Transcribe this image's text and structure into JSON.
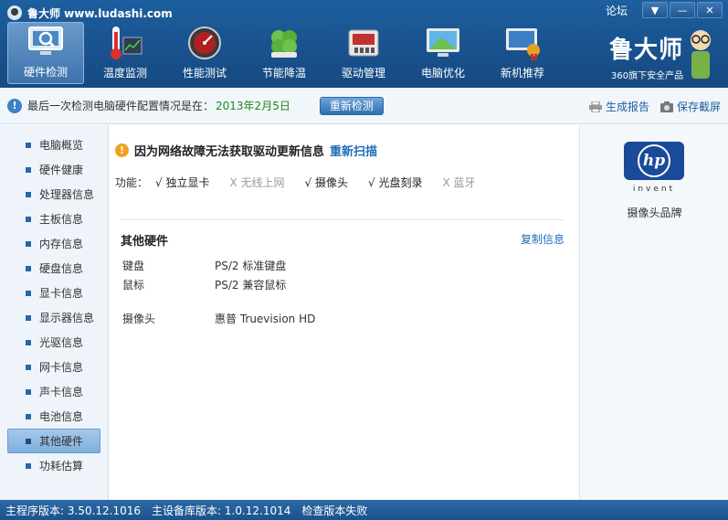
{
  "app": {
    "title": "鲁大师 www.ludashi.com",
    "forum": "论坛",
    "menu_glyph": "▼",
    "minimize_glyph": "—",
    "close_glyph": "✕"
  },
  "toolbar": [
    {
      "label": "硬件检测",
      "icon": "monitor-magnifier-icon",
      "active": true
    },
    {
      "label": "温度监测",
      "icon": "thermometer-icon",
      "active": false
    },
    {
      "label": "性能测试",
      "icon": "speedometer-icon",
      "active": false
    },
    {
      "label": "节能降温",
      "icon": "clover-icon",
      "active": false
    },
    {
      "label": "驱动管理",
      "icon": "driver-box-icon",
      "active": false
    },
    {
      "label": "电脑优化",
      "icon": "optimize-monitor-icon",
      "active": false
    },
    {
      "label": "新机推荐",
      "icon": "new-pc-icon",
      "active": false
    }
  ],
  "brand": {
    "name": "鲁大师",
    "tagline": "360旗下安全产品"
  },
  "infobar": {
    "message": "最后一次检测电脑硬件配置情况是在：",
    "date": "2013年2月5日",
    "recheck": "重新检测",
    "report": "生成报告",
    "screenshot": "保存截屏"
  },
  "sidebar": [
    {
      "label": "电脑概览"
    },
    {
      "label": "硬件健康"
    },
    {
      "label": "处理器信息"
    },
    {
      "label": "主板信息"
    },
    {
      "label": "内存信息"
    },
    {
      "label": "硬盘信息"
    },
    {
      "label": "显卡信息"
    },
    {
      "label": "显示器信息"
    },
    {
      "label": "光驱信息"
    },
    {
      "label": "网卡信息"
    },
    {
      "label": "声卡信息"
    },
    {
      "label": "电池信息"
    },
    {
      "label": "其他硬件",
      "active": true
    },
    {
      "label": "功耗估算"
    }
  ],
  "main": {
    "warning": "因为网络故障无法获取驱动更新信息",
    "rescan": "重新扫描",
    "features_label": "功能：",
    "features": [
      {
        "label": "√ 独立显卡",
        "on": true
      },
      {
        "label": "X 无线上网",
        "on": false
      },
      {
        "label": "√ 摄像头",
        "on": true
      },
      {
        "label": "√ 光盘刻录",
        "on": true
      },
      {
        "label": "X 蓝牙",
        "on": false
      }
    ],
    "section_title": "其他硬件",
    "copy": "复制信息",
    "rows": [
      {
        "key": "键盘",
        "value": "PS/2 标准键盘"
      },
      {
        "key": "鼠标",
        "value": "PS/2 兼容鼠标"
      },
      {
        "key": "摄像头",
        "value": "惠普 Truevision HD"
      }
    ]
  },
  "right_panel": {
    "logo_text": "hp",
    "logo_sub": "invent",
    "caption": "摄像头品牌"
  },
  "status": {
    "main_version": "主程序版本: 3.50.12.1016",
    "db_version": "主设备库版本: 1.0.12.1014",
    "update": "检查版本失败"
  }
}
